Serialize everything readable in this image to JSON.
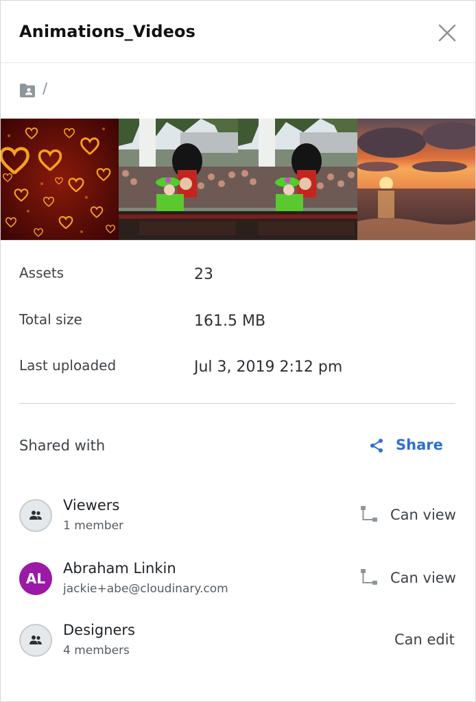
{
  "header": {
    "title": "Animations_Videos",
    "close_icon": "close-icon"
  },
  "path": {
    "folder_icon": "shared-folder-icon",
    "separator": "/"
  },
  "thumbnails": [
    {
      "name": "hearts-thumbnail"
    },
    {
      "name": "carriage-thumbnail"
    },
    {
      "name": "carriage-thumbnail-2"
    },
    {
      "name": "sunset-thumbnail"
    }
  ],
  "details": {
    "assets": {
      "label": "Assets",
      "value": "23"
    },
    "total_size": {
      "label": "Total size",
      "value": "161.5 MB"
    },
    "last_uploaded": {
      "label": "Last uploaded",
      "value": "Jul 3, 2019 2:12 pm"
    }
  },
  "sharing": {
    "label": "Shared with",
    "share_label": "Share",
    "accent": "#2d6fd2",
    "members": [
      {
        "name": "Viewers",
        "sub": "1 member",
        "avatar": "group-icon",
        "permission": "Can view",
        "permission_icon": "inherited-permission-icon"
      },
      {
        "name": "Abraham Linkin",
        "sub": "jackie+abe@cloudinary.com",
        "avatar_initials": "AL",
        "avatar_color": "#9a1aa6",
        "permission": "Can view",
        "permission_icon": "inherited-permission-icon"
      },
      {
        "name": "Designers",
        "sub": "4 members",
        "avatar": "group-icon",
        "permission": "Can edit"
      }
    ]
  }
}
